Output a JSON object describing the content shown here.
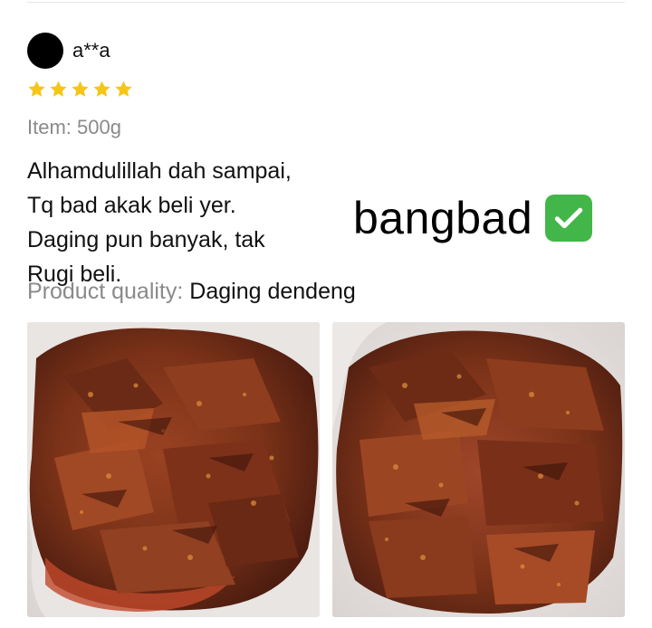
{
  "reviewer": {
    "name": "a**a",
    "rating": 5,
    "rating_max": 5
  },
  "review": {
    "variant": "Item: 500g",
    "text_lines": [
      "Alhamdulillah dah sampai,",
      "Tq bad akak beli yer.",
      "Daging pun banyak, tak",
      "Rugi beli."
    ],
    "quality_label": "Product quality:",
    "quality_value": "Daging dendeng"
  },
  "overlay": {
    "text": "bangbad",
    "badge_icon": "check-mark-button-icon"
  },
  "photos": [
    {
      "icon": "beef-rendang-photo"
    },
    {
      "icon": "beef-rendang-photo"
    }
  ],
  "colors": {
    "star": "#f5c518",
    "muted_text": "#8a8a8a",
    "check_badge": "#43b649",
    "meat_dark": "#5a2415",
    "meat_mid": "#8c3a1e",
    "meat_light": "#b9552a"
  }
}
